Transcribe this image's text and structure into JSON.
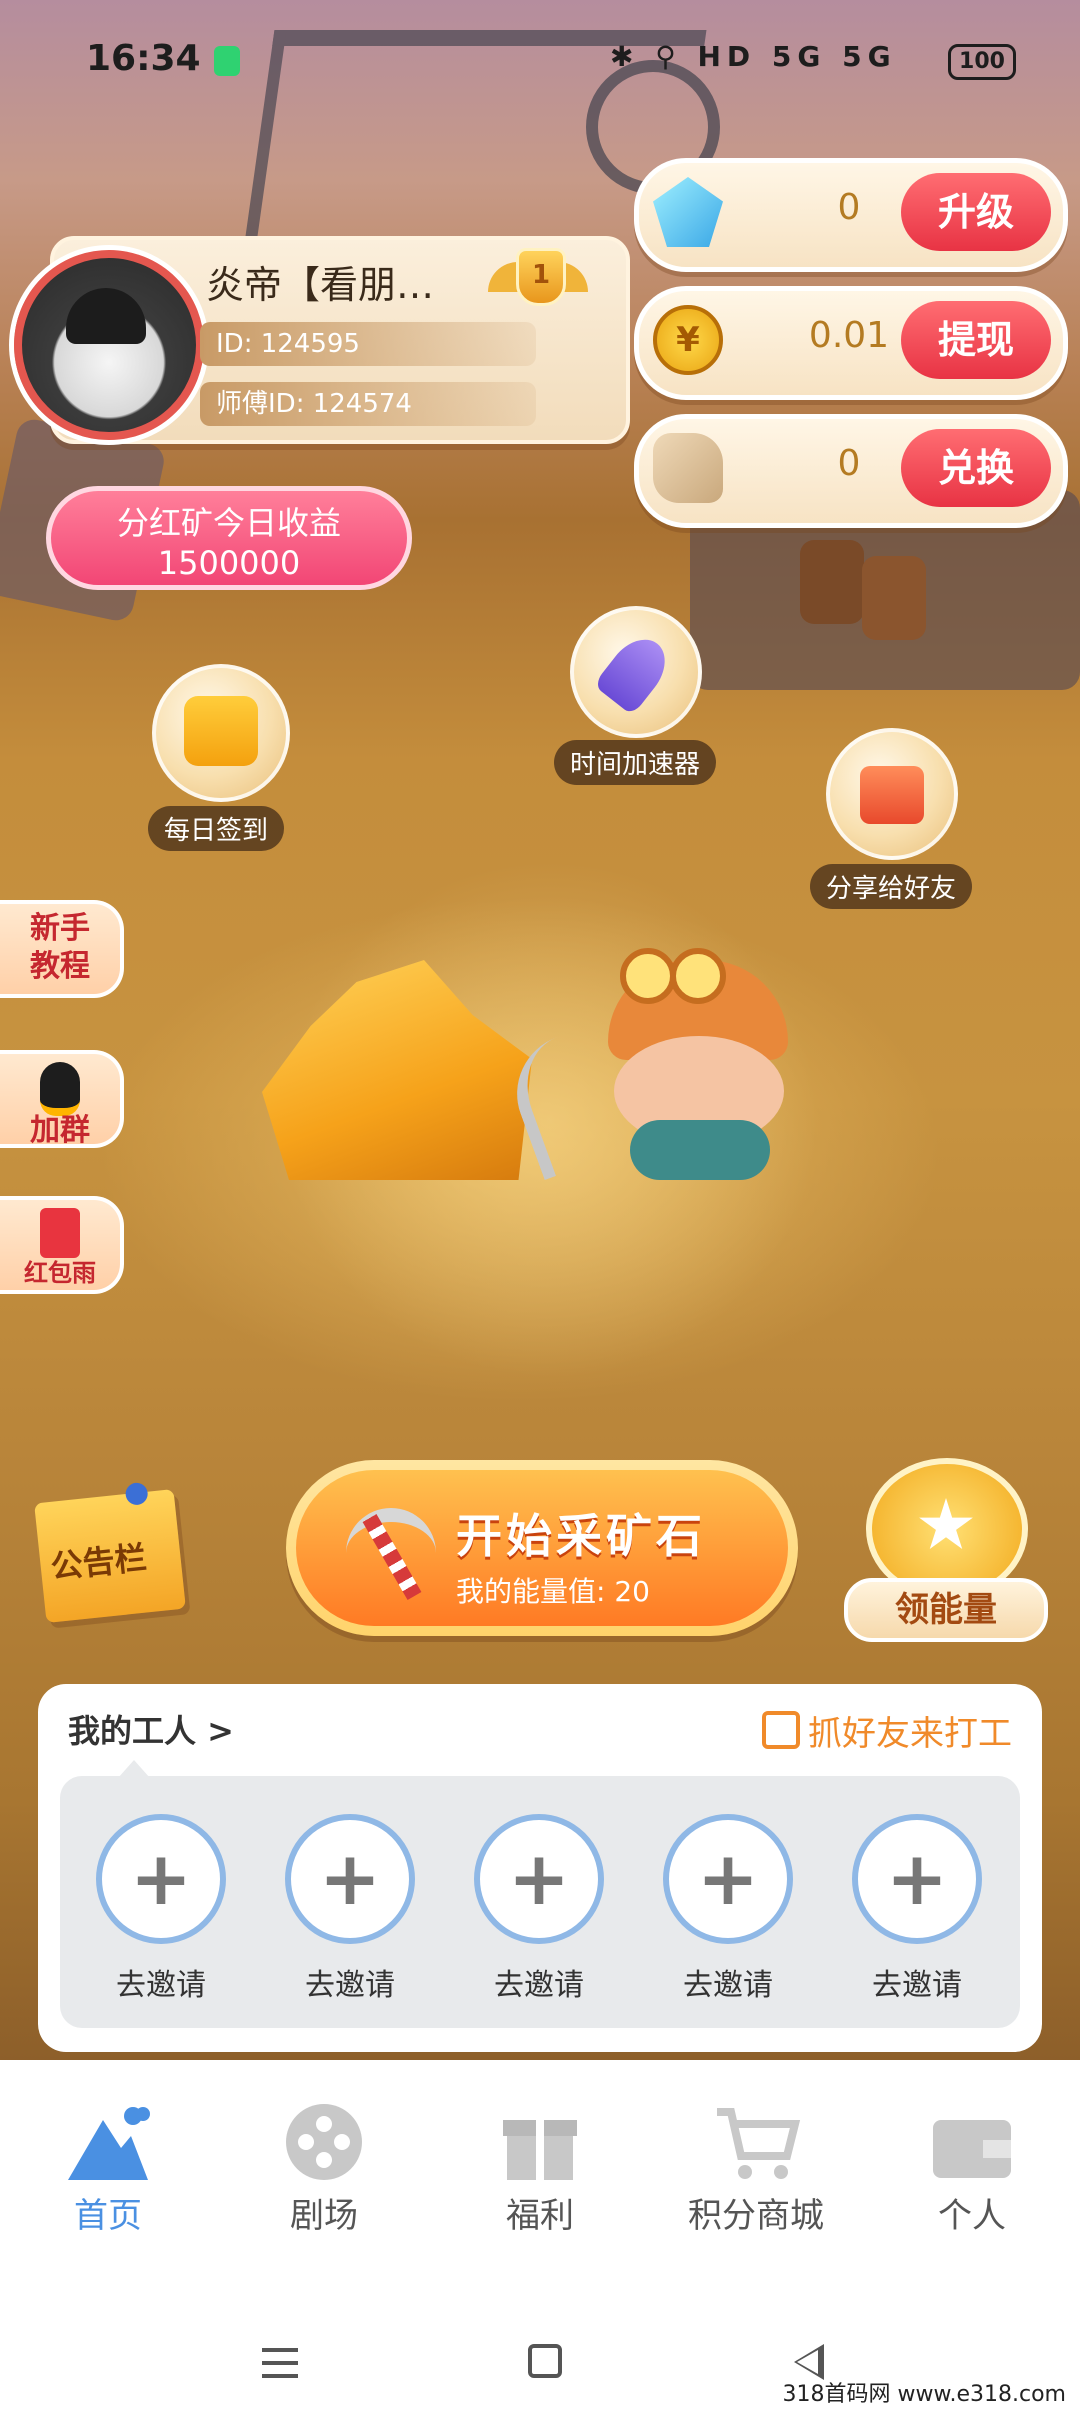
{
  "status": {
    "time": "16:34",
    "indicators": "✱ ⚲ HD 5G 5G",
    "battery": "100"
  },
  "profile": {
    "name": "炎帝【看朋…",
    "id": "ID: 124595",
    "master_id": "师傅ID: 124574",
    "level": "1"
  },
  "currencies": [
    {
      "icon": "gem-icon",
      "value": "0",
      "action": "升级"
    },
    {
      "icon": "yuan-coin-icon",
      "value": "0.01",
      "action": "提现"
    },
    {
      "icon": "stone-icon",
      "value": "0",
      "action": "兑换"
    }
  ],
  "earnings": {
    "line1": "分红矿今日收益",
    "line2": "1500000"
  },
  "features": {
    "checkin": "每日签到",
    "accelerator": "时间加速器",
    "share": "分享给好友"
  },
  "side_buttons": [
    {
      "label": "新手\n教程",
      "icon": "tutorial"
    },
    {
      "label": "加群",
      "icon": "qq-penguin-icon"
    },
    {
      "label": "红包雨",
      "icon": "red-envelope-icon"
    }
  ],
  "board": "公告栏",
  "start": {
    "title": "开始采矿石",
    "energy_label": "我的能量值: ",
    "energy_value": "20"
  },
  "energy": {
    "label": "领能量"
  },
  "workers": {
    "title": "我的工人 >",
    "invite_action": "抓好友来打工",
    "slot_label": "去邀请",
    "slots": [
      "去邀请",
      "去邀请",
      "去邀请",
      "去邀请",
      "去邀请"
    ]
  },
  "nav": [
    {
      "label": "首页",
      "icon": "mountain-icon",
      "active": true
    },
    {
      "label": "剧场",
      "icon": "film-reel-icon",
      "active": false
    },
    {
      "label": "福利",
      "icon": "gift-icon",
      "active": false
    },
    {
      "label": "积分商城",
      "icon": "cart-icon",
      "active": false
    },
    {
      "label": "个人",
      "icon": "wallet-icon",
      "active": false
    }
  ],
  "watermark": "318首码网 www.e318.com",
  "colors": {
    "accent": "#4a90e2",
    "button_red": "#e83344",
    "gold": "#b47b22"
  }
}
